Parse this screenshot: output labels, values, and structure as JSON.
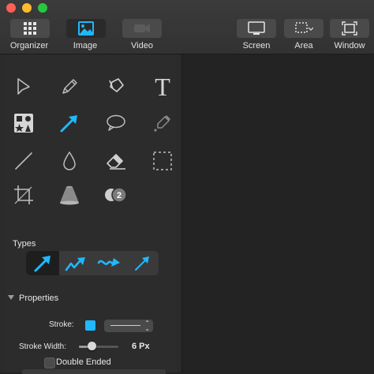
{
  "toolbar": {
    "buttons": [
      {
        "label": "Organizer",
        "icon": "grid-icon",
        "active": false
      },
      {
        "label": "Image",
        "icon": "image-icon",
        "active": true
      },
      {
        "label": "Video",
        "icon": "video-camera-icon",
        "active": false
      },
      {
        "label": "Screen",
        "icon": "monitor-icon",
        "active": false
      },
      {
        "label": "Area",
        "icon": "area-select-icon",
        "active": false
      },
      {
        "label": "Window",
        "icon": "window-capture-icon",
        "active": false
      }
    ]
  },
  "tools": [
    {
      "name": "pointer-tool-icon"
    },
    {
      "name": "pencil-tool-icon"
    },
    {
      "name": "fill-tool-icon"
    },
    {
      "name": "text-tool-icon",
      "glyph": "T"
    },
    {
      "name": "shapes-tool-icon"
    },
    {
      "name": "arrow-tool-icon",
      "active": true
    },
    {
      "name": "speech-bubble-tool-icon"
    },
    {
      "name": "highlighter-tool-icon"
    },
    {
      "name": "line-tool-icon"
    },
    {
      "name": "blur-drop-tool-icon"
    },
    {
      "name": "eraser-tool-icon"
    },
    {
      "name": "selection-tool-icon"
    },
    {
      "name": "crop-tool-icon"
    },
    {
      "name": "spotlight-tool-icon"
    },
    {
      "name": "counter-tool-icon",
      "glyph": "2"
    }
  ],
  "types": {
    "label": "Types",
    "options": [
      "straight-arrow",
      "zigzag-arrow",
      "curved-arrow",
      "thin-arrow"
    ],
    "selected_index": 0
  },
  "properties": {
    "label": "Properties",
    "stroke_label": "Stroke:",
    "stroke_color": "#1fb8ff",
    "stroke_width_label": "Stroke Width:",
    "stroke_width_value": "6 Px",
    "stroke_width_level": 0.25,
    "double_ended_label": "Double Ended",
    "double_ended_checked": false
  },
  "colors": {
    "accent": "#1fb8ff",
    "titlebar": "#353535",
    "panel": "#2c2c2c",
    "canvas": "#232323"
  }
}
